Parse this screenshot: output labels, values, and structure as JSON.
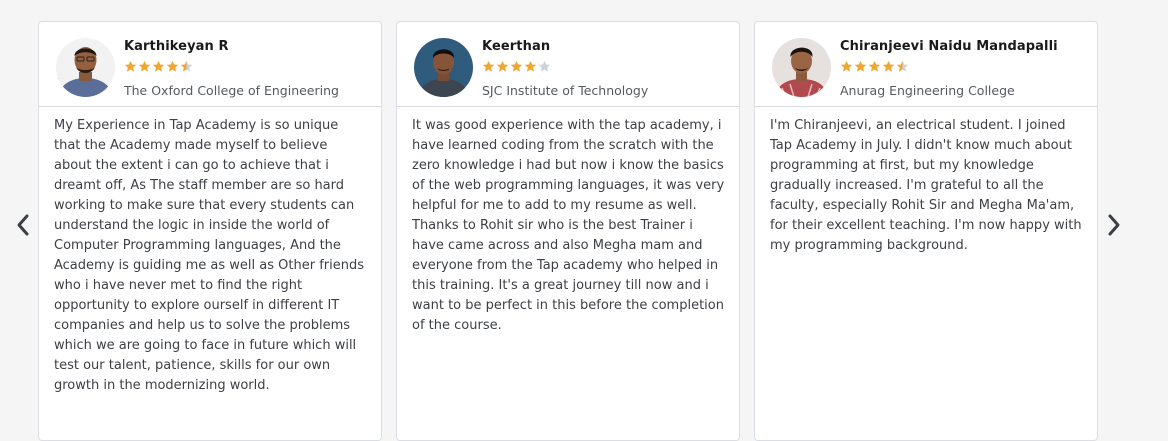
{
  "colors": {
    "star_filled": "#f1a630",
    "star_empty": "#cdd3dc",
    "arrow": "#3a3f45",
    "card_border": "#dcdde2",
    "background": "#f5f5f5"
  },
  "carousel": {
    "prev_icon": "chevron-left-icon",
    "next_icon": "chevron-right-icon"
  },
  "testimonials": [
    {
      "name": "Karthikeyan R",
      "rating": 4.5,
      "college": "The Oxford College of Engineering",
      "review": "My Experience in Tap Academy is so unique that the Academy made myself to believe about the extent i can go to achieve that i dreamt off, As The staff member are so hard working to make sure that every students can understand the logic in inside the world of Computer Programming languages, And the Academy is guiding me as well as Other friends who i have never met to find the right opportunity to explore ourself in different IT companies and help us to solve the problems which we are going to face in future which will test our talent, patience, skills for our own growth in the modernizing world."
    },
    {
      "name": "Keerthan",
      "rating": 4,
      "college": "SJC Institute of Technology",
      "review": "It was good experience with the tap academy, i have learned coding from the scratch with the zero knowledge i had but now i know the basics of the web programming languages, it was very helpful for me to add to my resume as well. Thanks to Rohit sir who is the best Trainer i have came across and also Megha mam and everyone from the Tap academy who helped in this training. It's a great journey till now and i want to be perfect in this before the completion of the course."
    },
    {
      "name": "Chiranjeevi Naidu Mandapalli",
      "rating": 4.5,
      "college": "Anurag Engineering College",
      "review": "I'm Chiranjeevi, an electrical student. I joined Tap Academy in July. I didn't know much about programming at first, but my knowledge gradually increased. I'm grateful to all the faculty, especially Rohit Sir and Megha Ma'am, for their excellent teaching. I'm now happy with my programming background."
    }
  ]
}
